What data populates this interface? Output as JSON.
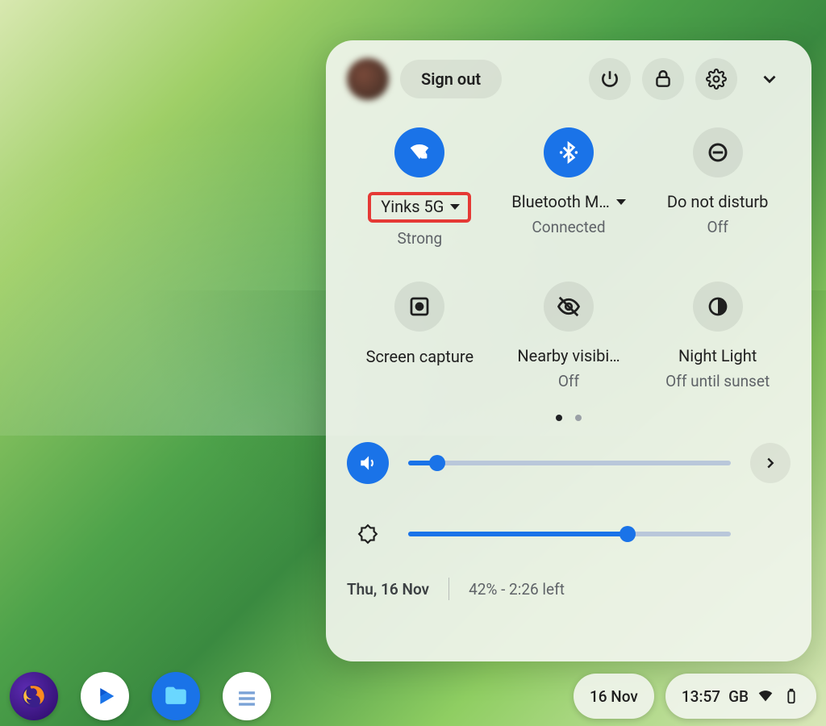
{
  "header": {
    "sign_out": "Sign out"
  },
  "tiles": {
    "wifi": {
      "label": "Yinks 5G",
      "status": "Strong",
      "on": true,
      "dropdown": true,
      "highlighted": true
    },
    "bluetooth": {
      "label": "Bluetooth M…",
      "status": "Connected",
      "on": true,
      "dropdown": true
    },
    "dnd": {
      "label": "Do not disturb",
      "status": "Off",
      "on": false,
      "dropdown": false
    },
    "capture": {
      "label": "Screen capture",
      "status": "",
      "on": false,
      "dropdown": false
    },
    "nearby": {
      "label": "Nearby visibi…",
      "status": "Off",
      "on": false,
      "dropdown": false
    },
    "nightlight": {
      "label": "Night Light",
      "status": "Off until sunset",
      "on": false,
      "dropdown": false
    }
  },
  "pager": {
    "current": 0,
    "count": 2
  },
  "sliders": {
    "volume": {
      "percent": 9
    },
    "brightness": {
      "percent": 68
    }
  },
  "footer": {
    "date": "Thu, 16 Nov",
    "battery": "42% - 2:26 left"
  },
  "shelf": {
    "date": "16 Nov",
    "time": "13:57",
    "locale": "GB"
  }
}
